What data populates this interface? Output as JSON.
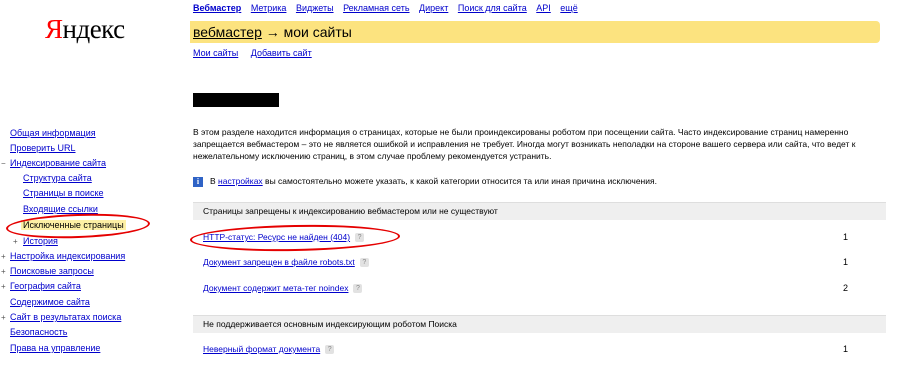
{
  "logo": {
    "first_letter": "Я",
    "rest": "ндекс"
  },
  "topnav": [
    "Вебмастер",
    "Метрика",
    "Виджеты",
    "Рекламная сеть",
    "Директ",
    "Поиск для сайта",
    "API",
    "ещё"
  ],
  "header": {
    "breadcrumb_link": "вебмастер",
    "arrow": " → ",
    "title": "мои сайты"
  },
  "subnav": [
    "Мои сайты",
    "Добавить сайт"
  ],
  "intro": "В этом разделе находится информация о страницах, которые не были проиндексированы роботом при посещении сайта. Часто индексирование страниц намеренно запрещается вебмастером – это не является ошибкой и исправления не требует. Иногда могут возникать неполадки на стороне вашего сервера или сайта, что ведет к нежелательному исключению страниц, в этом случае проблему рекомендуется устранить.",
  "info": {
    "icon": "i",
    "prefix": "В ",
    "link": "настройках",
    "suffix": " вы самостоятельно можете указать, к какой категории относится та или иная причина исключения."
  },
  "sections": [
    {
      "heading": "Страницы запрещены к индексированию вебмастером или не существуют",
      "rows": [
        {
          "label": "HTTP-статус: Ресурс не найден (404)",
          "count": "1"
        },
        {
          "label": "Документ запрещен в файле robots.txt",
          "count": "1"
        },
        {
          "label": "Документ содержит мета-тег noindex",
          "count": "2"
        }
      ]
    },
    {
      "heading": "Не поддерживается основным индексирующим роботом Поиска",
      "rows": [
        {
          "label": "Неверный формат документа",
          "count": "1"
        }
      ]
    }
  ],
  "help_icon": "?",
  "sidebar": {
    "items": [
      {
        "label": "Общая информация",
        "toggle": ""
      },
      {
        "label": "Проверить URL",
        "toggle": ""
      },
      {
        "label": "Индексирование сайта",
        "toggle": "−"
      },
      {
        "label": "Структура сайта",
        "toggle": ""
      },
      {
        "label": "Страницы в поиске",
        "toggle": ""
      },
      {
        "label": "Входящие ссылки",
        "toggle": ""
      },
      {
        "label": "Исключенные страницы",
        "toggle": ""
      },
      {
        "label": "История",
        "toggle": "+"
      },
      {
        "label": "Настройка индексирования",
        "toggle": "+"
      },
      {
        "label": "Поисковые запросы",
        "toggle": "+"
      },
      {
        "label": "География сайта",
        "toggle": "+"
      },
      {
        "label": "Содержимое сайта",
        "toggle": ""
      },
      {
        "label": "Сайт в результатах поиска",
        "toggle": "+"
      },
      {
        "label": "Безопасность",
        "toggle": ""
      },
      {
        "label": "Права на управление",
        "toggle": ""
      }
    ]
  },
  "colors": {
    "link": "#0000cc",
    "logo_red": "#ff0000",
    "header_bar": "#fce37f",
    "annotation": "#e50000",
    "section_bg": "#efefef"
  }
}
